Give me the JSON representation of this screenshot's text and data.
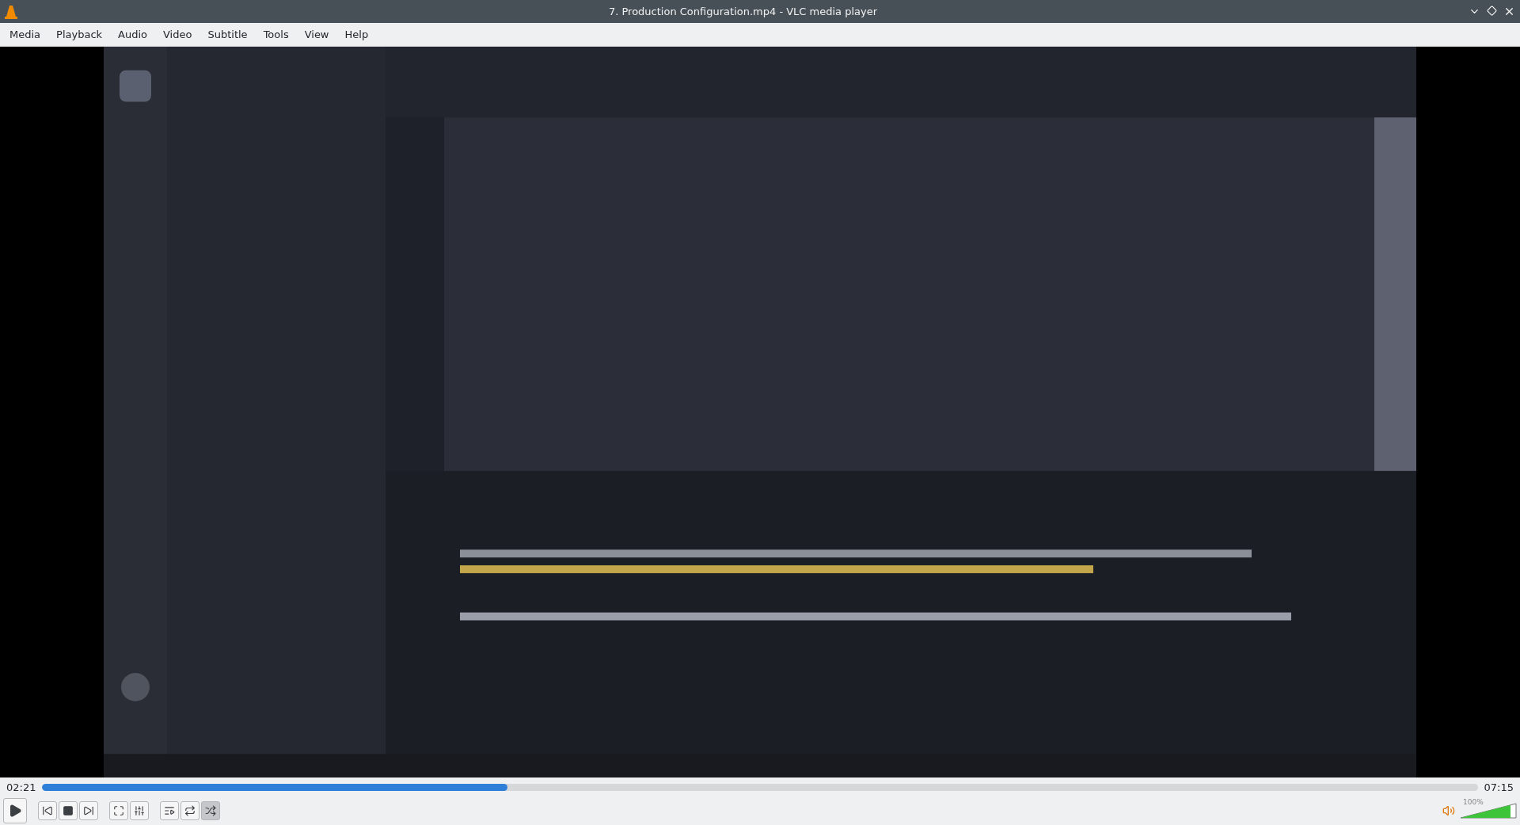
{
  "window": {
    "title": "7. Production Configuration.mp4 - VLC media player"
  },
  "menu": [
    "Media",
    "Playback",
    "Audio",
    "Video",
    "Subtitle",
    "Tools",
    "View",
    "Help"
  ],
  "video": {
    "kind": "picture"
  },
  "seek": {
    "elapsed": "02:21",
    "total": "07:15",
    "level": 0.324
  },
  "controls": [
    {
      "kind": "play",
      "on": false
    },
    {
      "kind": "prev",
      "on": false
    },
    {
      "kind": "stop",
      "on": false
    },
    {
      "kind": "next",
      "on": false
    },
    {
      "kind": "fullscreen",
      "on": false
    },
    {
      "kind": "effects",
      "on": false
    },
    {
      "kind": "playlist",
      "on": false
    },
    {
      "kind": "loop",
      "on": false
    },
    {
      "kind": "shuffle",
      "on": true
    }
  ],
  "volume": {
    "reading": "100%",
    "level": 0.9
  }
}
